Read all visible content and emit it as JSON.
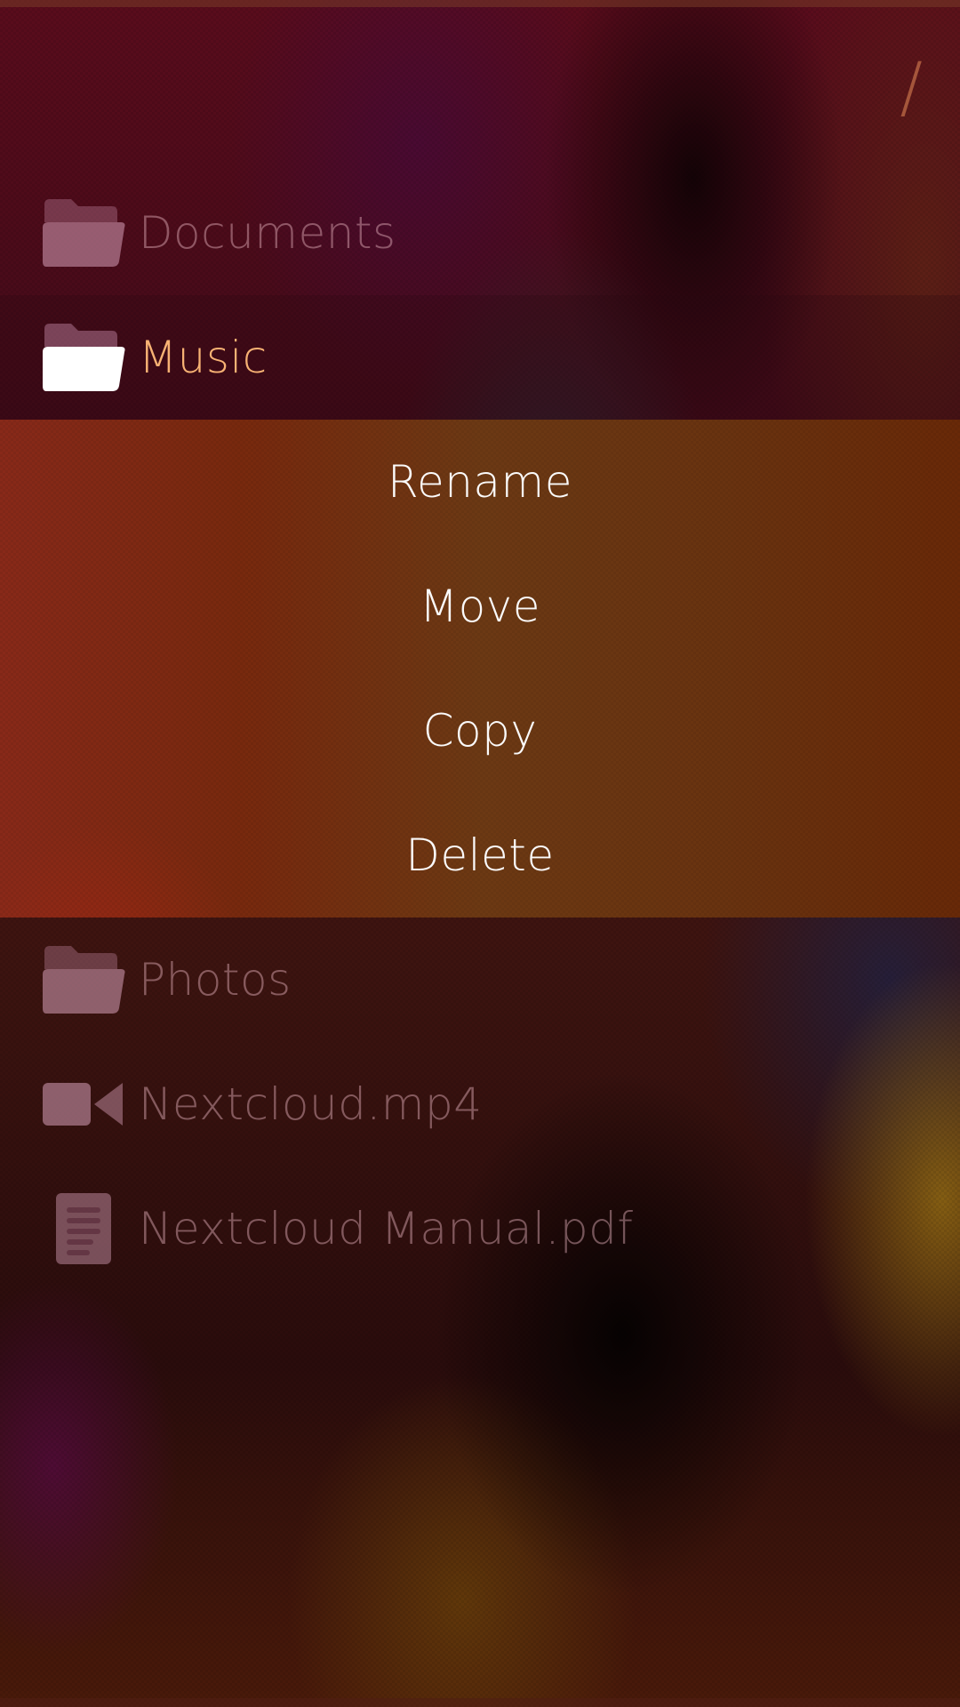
{
  "path": "/",
  "files": [
    {
      "name": "Documents",
      "icon": "folder-icon",
      "state": "dim"
    },
    {
      "name": "Music",
      "icon": "folder-icon",
      "state": "active"
    },
    {
      "name": "Photos",
      "icon": "folder-icon",
      "state": "dim"
    },
    {
      "name": "Nextcloud.mp4",
      "icon": "video-icon",
      "state": "dim"
    },
    {
      "name": "Nextcloud Manual.pdf",
      "icon": "document-icon",
      "state": "dim"
    }
  ],
  "context_menu": {
    "items": [
      "Rename",
      "Move",
      "Copy",
      "Delete"
    ]
  },
  "colors": {
    "highlight": "#f7b274",
    "menu_text": "#ffffff"
  }
}
